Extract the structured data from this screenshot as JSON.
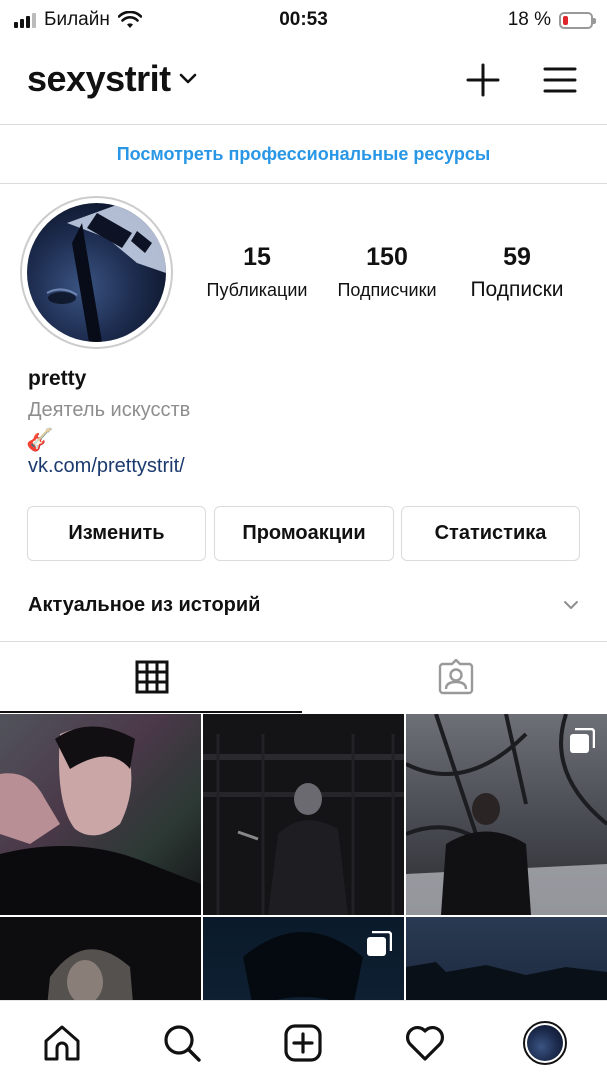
{
  "status_bar": {
    "carrier": "Билайн",
    "time": "00:53",
    "battery_percent": "18 %",
    "battery_level": 0.18
  },
  "header": {
    "username": "sexystrit",
    "icons": [
      "chevron-down-icon",
      "plus-icon",
      "menu-icon"
    ]
  },
  "banner": {
    "link": "Посмотреть профессиональные ресурсы"
  },
  "profile": {
    "stats": [
      {
        "value": "15",
        "label": "Публикации"
      },
      {
        "value": "150",
        "label": "Подписчики"
      },
      {
        "value": "59",
        "label": "Подписки"
      }
    ],
    "name": "pretty",
    "category": "Деятель искусств",
    "emoji": "🎸",
    "link": "vk.com/prettystrit/"
  },
  "actions": {
    "edit": "Изменить",
    "promotions": "Промоакции",
    "insights": "Статистика"
  },
  "highlights": {
    "label": "Актуальное из историй"
  },
  "tabs": {
    "items": [
      "grid-icon",
      "tagged-icon"
    ],
    "active": "grid"
  },
  "grid": {
    "posts": [
      {
        "multiple": false
      },
      {
        "multiple": false
      },
      {
        "multiple": true
      },
      {
        "multiple": false
      },
      {
        "multiple": true
      },
      {
        "multiple": false
      }
    ]
  },
  "bottom_nav": {
    "items": [
      "home-icon",
      "search-icon",
      "new-post-icon",
      "activity-heart-icon",
      "profile-avatar"
    ]
  },
  "colors": {
    "link_blue": "#2a97e6",
    "bio_link": "#1b3a6e",
    "secondary_text": "#8e8e8e",
    "battery_low": "#e0262c"
  }
}
